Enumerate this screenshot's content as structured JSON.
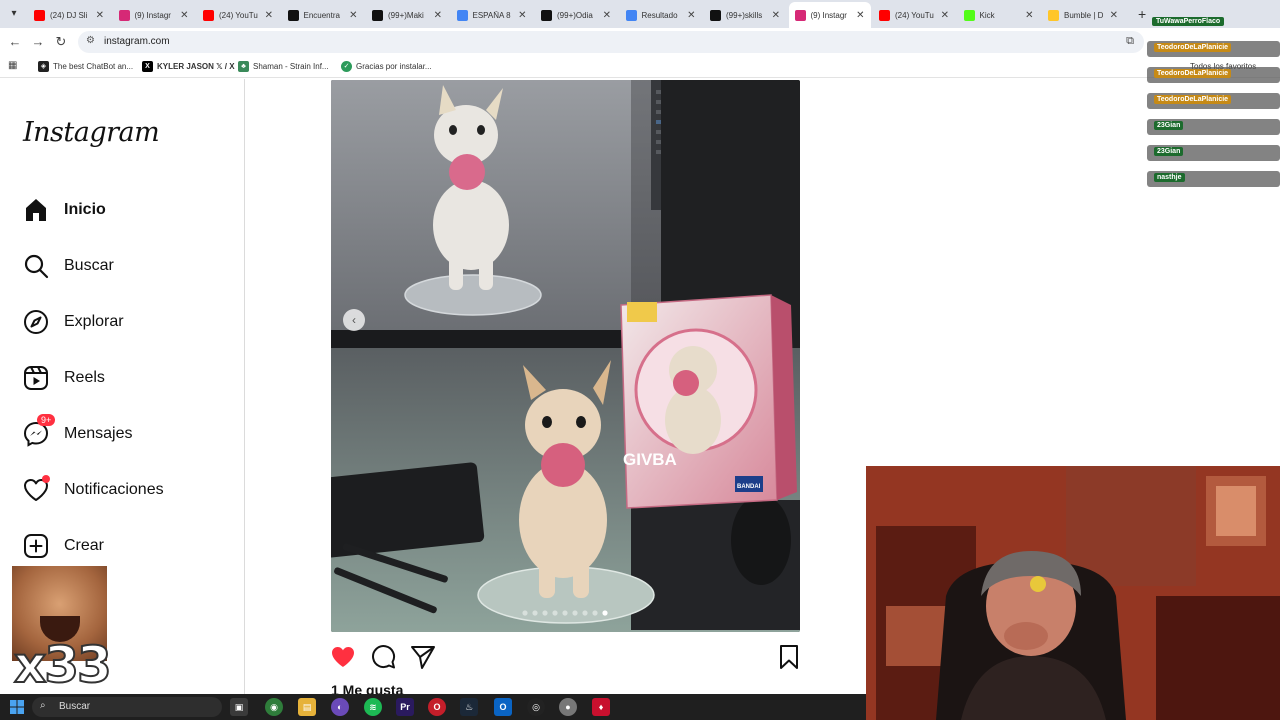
{
  "browser": {
    "tabs": [
      {
        "title": "(24) DJ Sli",
        "fav": "youtube",
        "color": "#ff0000",
        "active": false
      },
      {
        "title": "(9) Instagr",
        "fav": "instagram",
        "color": "#d62976",
        "active": false
      },
      {
        "title": "(24) YouTu",
        "fav": "youtube",
        "color": "#ff0000",
        "active": false
      },
      {
        "title": "Encuentra",
        "fav": "tiktok",
        "color": "#111111",
        "active": false
      },
      {
        "title": "(99+)Maki",
        "fav": "tiktok",
        "color": "#111111",
        "active": false
      },
      {
        "title": "ESPAÑA 8",
        "fav": "google",
        "color": "#4285f4",
        "active": false
      },
      {
        "title": "(99+)Odia",
        "fav": "tiktok",
        "color": "#111111",
        "active": false
      },
      {
        "title": "Resultado",
        "fav": "google",
        "color": "#4285f4",
        "active": false
      },
      {
        "title": "(99+)skills",
        "fav": "tiktok",
        "color": "#111111",
        "active": false
      },
      {
        "title": "(9) Instagr",
        "fav": "instagram",
        "color": "#d62976",
        "active": true
      },
      {
        "title": "(24) YouTu",
        "fav": "youtube",
        "color": "#ff0000",
        "active": false
      },
      {
        "title": "Kick",
        "fav": "kick",
        "color": "#53fc18",
        "active": false
      },
      {
        "title": "Bumble | D",
        "fav": "bumble",
        "color": "#ffc629",
        "active": false
      }
    ],
    "url": "instagram.com",
    "bookmarks": [
      {
        "label": "The best ChatBot an...",
        "fav": "chatbot"
      },
      {
        "label": "KYLER JASON 𝕏 / X",
        "fav": "x"
      },
      {
        "label": "Shaman - Strain Inf...",
        "fav": "leaf"
      },
      {
        "label": "Gracias por instalar...",
        "fav": "shield"
      }
    ],
    "all_favorites": "Todos los favoritos"
  },
  "instagram": {
    "logo": "Instagram",
    "nav": [
      {
        "label": "Inicio",
        "icon": "home-icon",
        "active": true
      },
      {
        "label": "Buscar",
        "icon": "search-icon",
        "active": false
      },
      {
        "label": "Explorar",
        "icon": "compass-icon",
        "active": false
      },
      {
        "label": "Reels",
        "icon": "reels-icon",
        "active": false
      },
      {
        "label": "Mensajes",
        "icon": "messenger-icon",
        "active": false,
        "badge": "9+"
      },
      {
        "label": "Notificaciones",
        "icon": "heart-icon",
        "active": false,
        "dot": true
      },
      {
        "label": "Crear",
        "icon": "plus-square-icon",
        "active": false
      }
    ],
    "post": {
      "likes": "1 Me gusta",
      "carousel_total": 9,
      "carousel_index": 9,
      "liked": true,
      "box_brand": "GIVBA",
      "box_maker": "BANDAI"
    }
  },
  "overlay": {
    "emote_count": "x33",
    "chat_top": "TuWawaPerroFlaco",
    "chat": [
      {
        "user": "TeodoroDeLaPlanicie",
        "color": "#c68a16"
      },
      {
        "user": "TeodoroDeLaPlanicie",
        "color": "#c68a16"
      },
      {
        "user": "TeodoroDeLaPlanicie",
        "color": "#c68a16"
      },
      {
        "user": "23Gian",
        "color": "#1c6b2d"
      },
      {
        "user": "23Gian",
        "color": "#1c6b2d"
      },
      {
        "user": "nasthje",
        "color": "#1c6b2d"
      }
    ]
  },
  "taskbar": {
    "search_label": "Buscar"
  }
}
